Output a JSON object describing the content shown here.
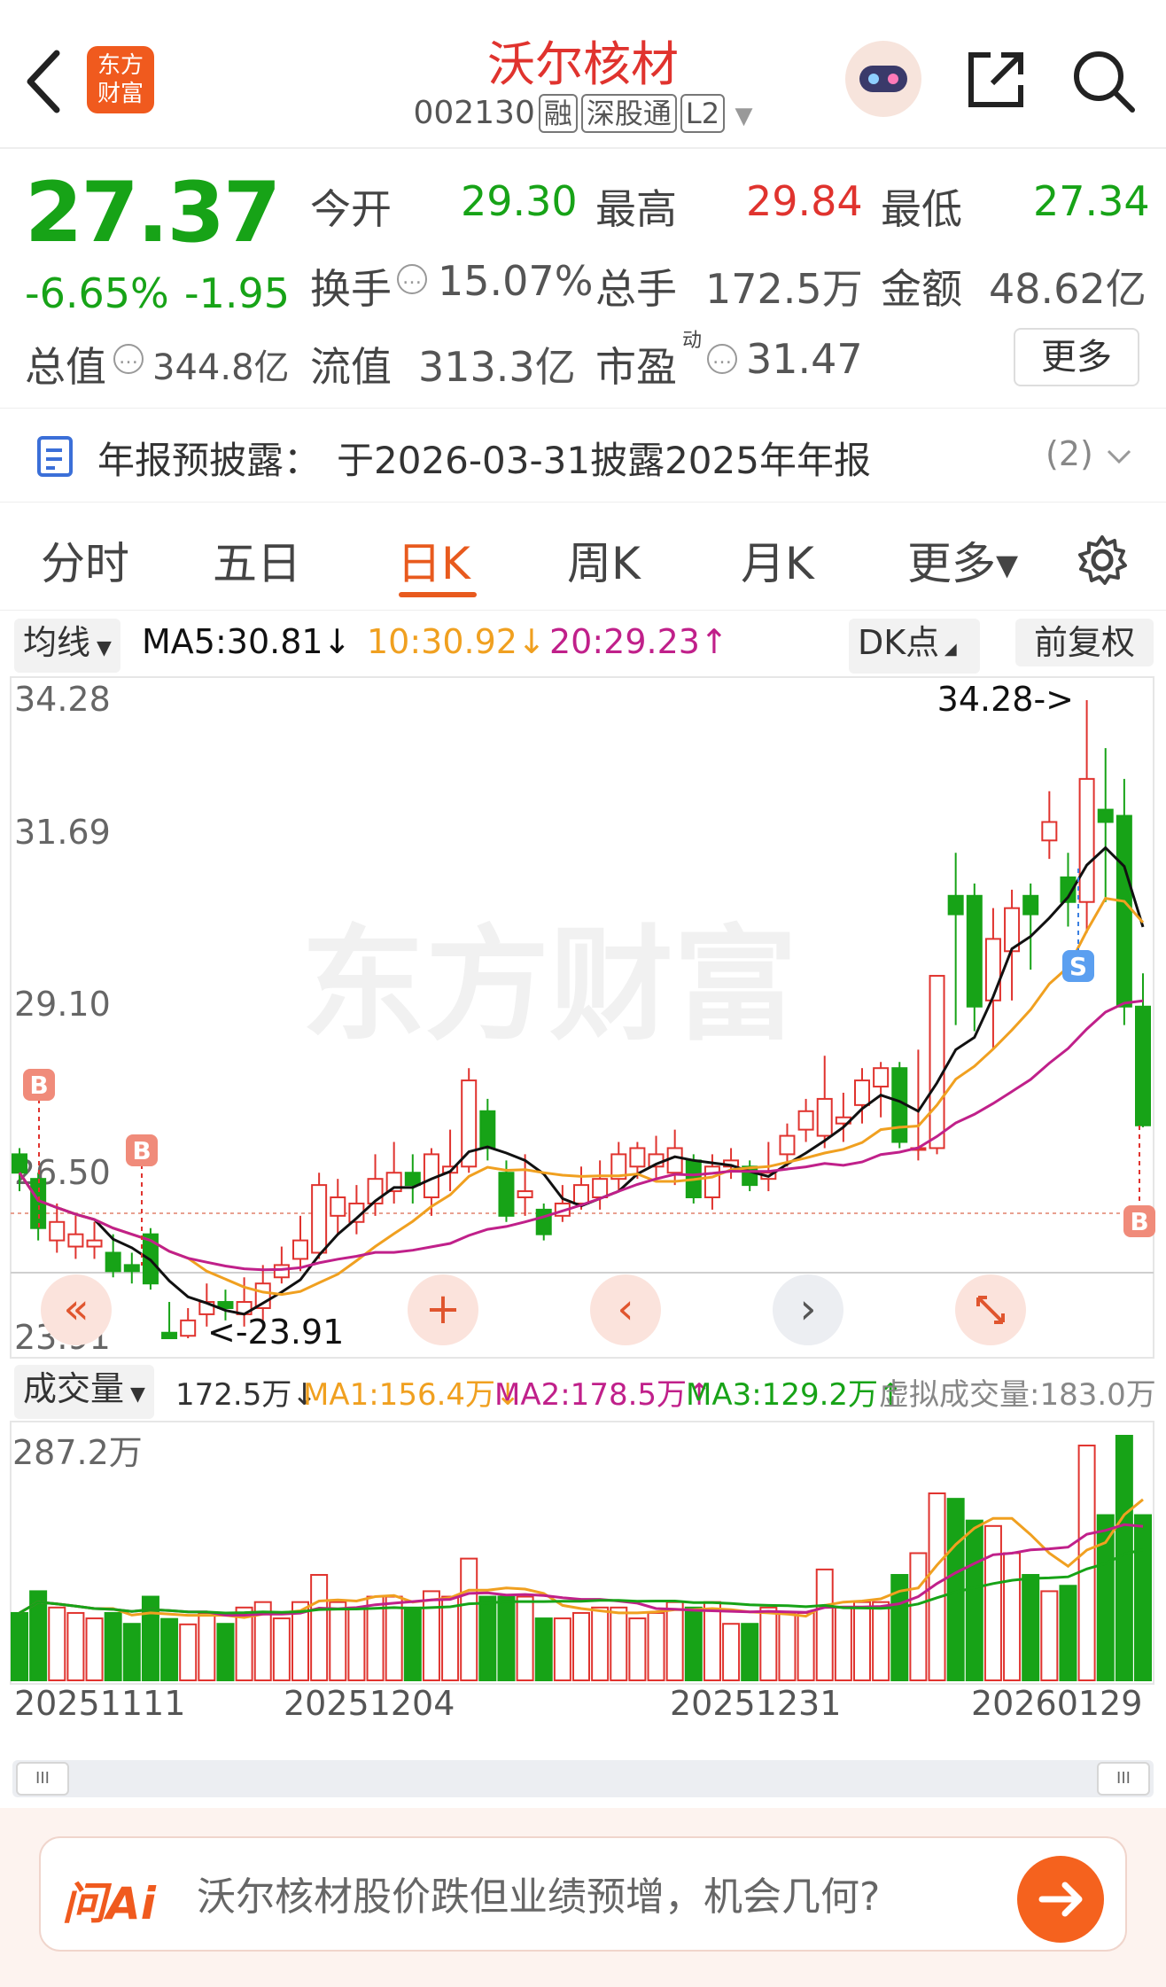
{
  "header": {
    "back_icon": "chevron-left-icon",
    "logo_text_1": "东方",
    "logo_text_2": "财富",
    "title": "沃尔核材",
    "code": "002130",
    "tags": [
      "融",
      "深股通",
      "L2"
    ],
    "dropdown_icon": "triangle-down-icon",
    "avatar_icon": "robot-avatar-icon",
    "share_icon": "share-icon",
    "search_icon": "search-icon"
  },
  "quote": {
    "price": "27.37",
    "change_pct": "-6.65%",
    "change": "-1.95",
    "open_label": "今开",
    "open": "29.30",
    "high_label": "最高",
    "high": "29.84",
    "low_label": "最低",
    "low": "27.34",
    "turnover_label": "换手",
    "turnover": "15.07%",
    "volume_label": "总手",
    "volume": "172.5万",
    "amount_label": "金额",
    "amount": "48.62亿",
    "mktcap_label": "总值",
    "mktcap": "344.8亿",
    "float_label": "流值",
    "float": "313.3亿",
    "pe_label": "市盈",
    "pe_sup": "动",
    "pe": "31.47",
    "more_label": "更多"
  },
  "notice": {
    "icon": "document-icon",
    "label": "年报预披露：",
    "text": "于2026-03-31披露2025年年报",
    "count": "(2)"
  },
  "tabs": [
    {
      "label": "分时",
      "active": false
    },
    {
      "label": "五日",
      "active": false
    },
    {
      "label": "日K",
      "active": true
    },
    {
      "label": "周K",
      "active": false
    },
    {
      "label": "月K",
      "active": false
    },
    {
      "label": "更多▾",
      "active": false
    }
  ],
  "settings_icon": "gear-icon",
  "ma_legend": {
    "selector": "均线",
    "ma5": "MA5:30.81↓",
    "ma10": "10:30.92↓",
    "ma20": "20:29.23↑",
    "dk": "DK点",
    "adjust": "前复权"
  },
  "kline": {
    "y_ticks": [
      "34.28",
      "31.69",
      "29.10",
      "26.50",
      "23.91"
    ],
    "high_note": "34.28->",
    "low_note": "<-23.91",
    "watermark": "东方财富",
    "marker_b": "B",
    "marker_s": "S"
  },
  "controls": {
    "rewind": "«",
    "plus": "+",
    "prev": "‹",
    "next": "›",
    "expand_icon": "expand-icon"
  },
  "vol_legend": {
    "selector": "成交量",
    "vol": "172.5万↓",
    "ma1": "MA1:156.4万↓",
    "ma2": "MA2:178.5万↑",
    "ma3": "MA3:129.2万↑",
    "virtual": "虚拟成交量:183.0万",
    "max_tick": "287.2万"
  },
  "dates": [
    "20251111",
    "20251204",
    "20251231",
    "20260129"
  ],
  "scrollbar": {
    "left": "III",
    "right": "III"
  },
  "ai": {
    "logo": "问Ai",
    "text": "沃尔核材股价跌但业绩预增，机会几何?",
    "arrow_icon": "arrow-right-icon"
  },
  "colors": {
    "up": "#e0332e",
    "down": "#17a317",
    "ma5": "#111111",
    "ma10": "#f0a020",
    "ma20": "#c0208a",
    "accent": "#ff6a00"
  },
  "chart_data": {
    "type": "candlestick",
    "title": "",
    "y_range": [
      23.91,
      34.28
    ],
    "candles": [
      {
        "o": 26.9,
        "c": 26.6,
        "h": 27.0,
        "l": 26.3
      },
      {
        "o": 26.5,
        "c": 25.7,
        "h": 26.6,
        "l": 25.5
      },
      {
        "o": 25.5,
        "c": 25.8,
        "h": 26.1,
        "l": 25.3
      },
      {
        "o": 25.4,
        "c": 25.6,
        "h": 25.9,
        "l": 25.2
      },
      {
        "o": 25.4,
        "c": 25.5,
        "h": 25.8,
        "l": 25.2
      },
      {
        "o": 25.3,
        "c": 25.0,
        "h": 25.6,
        "l": 24.9
      },
      {
        "o": 25.1,
        "c": 25.0,
        "h": 25.3,
        "l": 24.8
      },
      {
        "o": 25.6,
        "c": 24.8,
        "h": 25.7,
        "l": 24.7
      },
      {
        "o": 24.0,
        "c": 23.91,
        "h": 24.5,
        "l": 23.91
      },
      {
        "o": 23.95,
        "c": 24.2,
        "h": 24.4,
        "l": 23.91
      },
      {
        "o": 24.3,
        "c": 24.5,
        "h": 24.8,
        "l": 24.1
      },
      {
        "o": 24.5,
        "c": 24.4,
        "h": 24.7,
        "l": 24.2
      },
      {
        "o": 24.3,
        "c": 24.5,
        "h": 24.9,
        "l": 24.1
      },
      {
        "o": 24.4,
        "c": 24.8,
        "h": 25.1,
        "l": 24.2
      },
      {
        "o": 24.9,
        "c": 25.1,
        "h": 25.4,
        "l": 24.8
      },
      {
        "o": 25.2,
        "c": 25.5,
        "h": 25.9,
        "l": 25.0
      },
      {
        "o": 25.3,
        "c": 26.4,
        "h": 26.6,
        "l": 25.2
      },
      {
        "o": 25.9,
        "c": 26.2,
        "h": 26.5,
        "l": 25.6
      },
      {
        "o": 25.8,
        "c": 26.1,
        "h": 26.4,
        "l": 25.6
      },
      {
        "o": 26.1,
        "c": 26.5,
        "h": 26.9,
        "l": 25.9
      },
      {
        "o": 26.3,
        "c": 26.6,
        "h": 27.1,
        "l": 26.1
      },
      {
        "o": 26.6,
        "c": 26.4,
        "h": 26.9,
        "l": 26.1
      },
      {
        "o": 26.2,
        "c": 26.9,
        "h": 27.0,
        "l": 25.9
      },
      {
        "o": 26.6,
        "c": 26.7,
        "h": 27.3,
        "l": 26.3
      },
      {
        "o": 26.7,
        "c": 28.1,
        "h": 28.3,
        "l": 26.6
      },
      {
        "o": 27.6,
        "c": 27.0,
        "h": 27.8,
        "l": 26.8
      },
      {
        "o": 26.6,
        "c": 25.9,
        "h": 26.8,
        "l": 25.8
      },
      {
        "o": 26.2,
        "c": 26.3,
        "h": 26.9,
        "l": 25.9
      },
      {
        "o": 26.0,
        "c": 25.6,
        "h": 26.1,
        "l": 25.5
      },
      {
        "o": 25.9,
        "c": 26.1,
        "h": 26.4,
        "l": 25.8
      },
      {
        "o": 26.1,
        "c": 26.4,
        "h": 26.7,
        "l": 26.0
      },
      {
        "o": 26.2,
        "c": 26.5,
        "h": 26.8,
        "l": 26.0
      },
      {
        "o": 26.5,
        "c": 26.9,
        "h": 27.1,
        "l": 26.3
      },
      {
        "o": 26.7,
        "c": 27.0,
        "h": 27.1,
        "l": 26.5
      },
      {
        "o": 26.7,
        "c": 26.9,
        "h": 27.2,
        "l": 26.5
      },
      {
        "o": 26.6,
        "c": 27.0,
        "h": 27.3,
        "l": 26.4
      },
      {
        "o": 26.8,
        "c": 26.2,
        "h": 26.9,
        "l": 26.1
      },
      {
        "o": 26.2,
        "c": 26.7,
        "h": 26.9,
        "l": 26.0
      },
      {
        "o": 26.7,
        "c": 26.8,
        "h": 27.0,
        "l": 26.5
      },
      {
        "o": 26.7,
        "c": 26.4,
        "h": 26.8,
        "l": 26.3
      },
      {
        "o": 26.5,
        "c": 26.6,
        "h": 27.1,
        "l": 26.3
      },
      {
        "o": 26.9,
        "c": 27.2,
        "h": 27.4,
        "l": 26.7
      },
      {
        "o": 27.3,
        "c": 27.6,
        "h": 27.8,
        "l": 27.1
      },
      {
        "o": 27.2,
        "c": 27.8,
        "h": 28.5,
        "l": 27.0
      },
      {
        "o": 27.4,
        "c": 27.5,
        "h": 27.9,
        "l": 27.1
      },
      {
        "o": 27.7,
        "c": 28.1,
        "h": 28.3,
        "l": 27.4
      },
      {
        "o": 28.0,
        "c": 28.3,
        "h": 28.4,
        "l": 27.5
      },
      {
        "o": 28.3,
        "c": 27.1,
        "h": 28.4,
        "l": 27.0
      },
      {
        "o": 27.0,
        "c": 27.0,
        "h": 28.6,
        "l": 26.8
      },
      {
        "o": 27.0,
        "c": 29.8,
        "h": 29.8,
        "l": 26.9
      },
      {
        "o": 31.1,
        "c": 30.8,
        "h": 31.8,
        "l": 29.0
      },
      {
        "o": 31.1,
        "c": 29.3,
        "h": 31.3,
        "l": 28.9
      },
      {
        "o": 29.4,
        "c": 30.4,
        "h": 30.9,
        "l": 28.6
      },
      {
        "o": 30.2,
        "c": 30.9,
        "h": 31.2,
        "l": 29.4
      },
      {
        "o": 31.1,
        "c": 30.8,
        "h": 31.3,
        "l": 29.9
      },
      {
        "o": 32.0,
        "c": 32.3,
        "h": 32.8,
        "l": 31.7
      },
      {
        "o": 31.4,
        "c": 31.0,
        "h": 31.8,
        "l": 30.6
      },
      {
        "o": 31.0,
        "c": 33.0,
        "h": 34.28,
        "l": 30.5
      },
      {
        "o": 32.5,
        "c": 32.3,
        "h": 33.5,
        "l": 31.0
      },
      {
        "o": 32.4,
        "c": 29.3,
        "h": 33.0,
        "l": 29.0
      },
      {
        "o": 29.3,
        "c": 27.37,
        "h": 29.84,
        "l": 27.34
      }
    ],
    "volume_max": "287.2万"
  }
}
